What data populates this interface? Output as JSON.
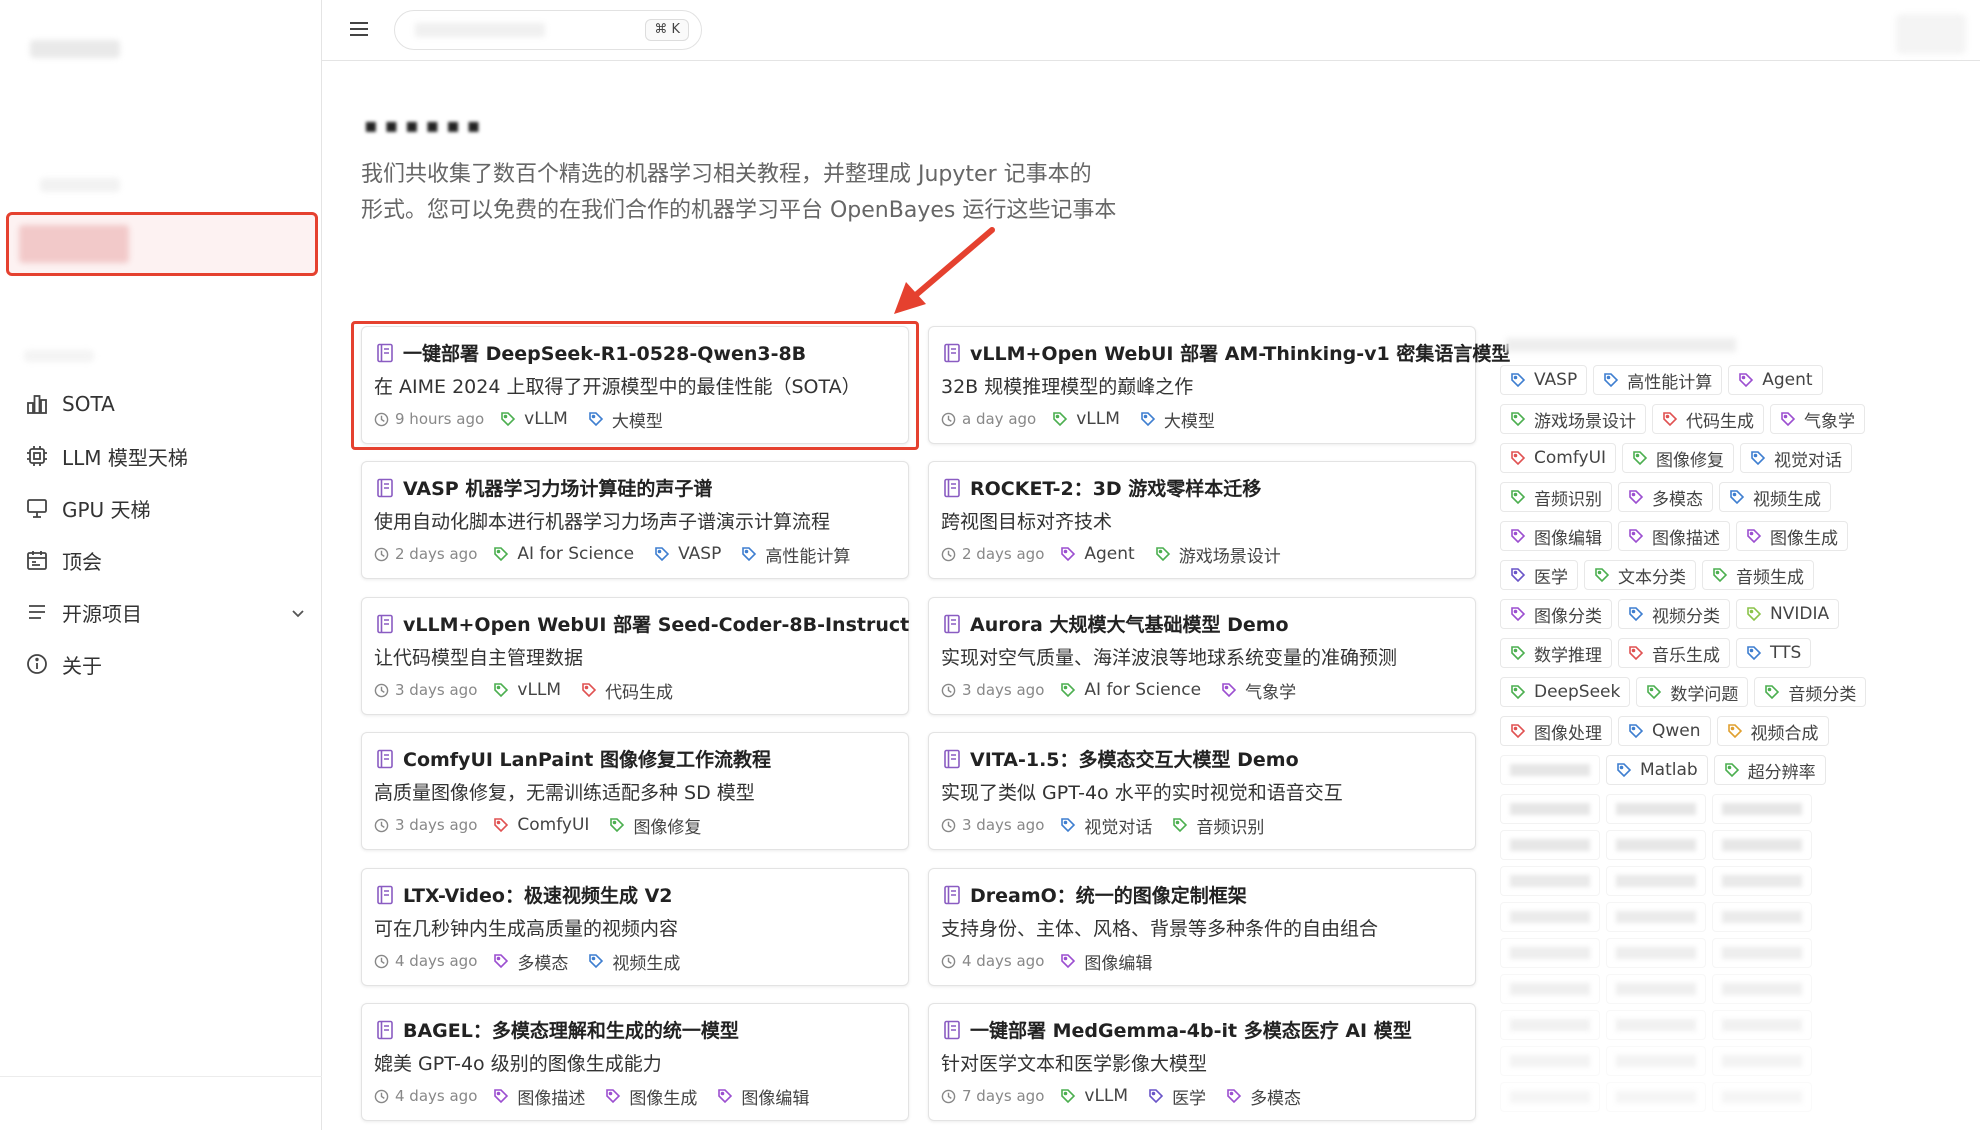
{
  "search": {
    "shortcut": "⌘ K"
  },
  "sidebar": {
    "items": [
      {
        "label": "SOTA",
        "icon": "bar-chart-icon"
      },
      {
        "label": "LLM 模型天梯",
        "icon": "chip-icon"
      },
      {
        "label": "GPU 天梯",
        "icon": "monitor-icon"
      },
      {
        "label": "顶会",
        "icon": "calendar-icon"
      },
      {
        "label": "开源项目",
        "icon": "list-icon",
        "expandable": true
      },
      {
        "label": "关于",
        "icon": "info-icon"
      }
    ]
  },
  "main": {
    "intro": "我们共收集了数百个精选的机器学习相关教程，并整理成 Jupyter 记事本的形式。您可以免费的在我们合作的机器学习平台 OpenBayes 运行这些记事本",
    "intro_line1": "我们共收集了数百个精选的机器学习相关教程，并整理成 Jupyter 记事本的",
    "intro_line2": "形式。您可以免费的在我们合作的机器学习平台 OpenBayes 运行这些记事本",
    "cards": [
      {
        "title": "一键部署 DeepSeek-R1-0528-Qwen3-8B",
        "desc": "在 AIME 2024 上取得了开源模型中的最佳性能（SOTA）",
        "time": "9 hours ago",
        "tags": [
          {
            "name": "vLLM",
            "color": "#4caf50"
          },
          {
            "name": "大模型",
            "color": "#3f7fd0"
          }
        ],
        "highlighted": true
      },
      {
        "title": "vLLM+Open WebUI 部署 AM-Thinking-v1 密集语言模型",
        "desc": "32B 规模推理模型的巅峰之作",
        "time": "a day ago",
        "tags": [
          {
            "name": "vLLM",
            "color": "#4caf50"
          },
          {
            "name": "大模型",
            "color": "#3f7fd0"
          }
        ]
      },
      {
        "title": "VASP 机器学习力场计算硅的声子谱",
        "desc": "使用自动化脚本进行机器学习力场声子谱演示计算流程",
        "time": "2 days ago",
        "tags": [
          {
            "name": "AI for Science",
            "color": "#4caf50"
          },
          {
            "name": "VASP",
            "color": "#3f7fd0"
          },
          {
            "name": "高性能计算",
            "color": "#3f7fd0"
          }
        ]
      },
      {
        "title": "ROCKET-2：3D 游戏零样本迁移",
        "desc": "跨视图目标对齐技术",
        "time": "2 days ago",
        "tags": [
          {
            "name": "Agent",
            "color": "#9c4fd0"
          },
          {
            "name": "游戏场景设计",
            "color": "#4caf50"
          }
        ]
      },
      {
        "title": "vLLM+Open WebUI 部署 Seed-Coder-8B-Instruct",
        "desc": "让代码模型自主管理数据",
        "time": "3 days ago",
        "tags": [
          {
            "name": "vLLM",
            "color": "#4caf50"
          },
          {
            "name": "代码生成",
            "color": "#e05252"
          }
        ]
      },
      {
        "title": "Aurora 大规模大气基础模型 Demo",
        "desc": "实现对空气质量、海洋波浪等地球系统变量的准确预测",
        "time": "3 days ago",
        "tags": [
          {
            "name": "AI for Science",
            "color": "#4caf50"
          },
          {
            "name": "气象学",
            "color": "#9c4fd0"
          }
        ]
      },
      {
        "title": "ComfyUI LanPaint 图像修复工作流教程",
        "desc": "高质量图像修复，无需训练适配多种 SD 模型",
        "time": "3 days ago",
        "tags": [
          {
            "name": "ComfyUI",
            "color": "#e05252"
          },
          {
            "name": "图像修复",
            "color": "#4caf50"
          }
        ]
      },
      {
        "title": "VITA-1.5：多模态交互大模型 Demo",
        "desc": "实现了类似 GPT-4o 水平的实时视觉和语音交互",
        "time": "3 days ago",
        "tags": [
          {
            "name": "视觉对话",
            "color": "#3f7fd0"
          },
          {
            "name": "音频识别",
            "color": "#4caf50"
          }
        ]
      },
      {
        "title": "LTX-Video：极速视频生成 V2",
        "desc": "可在几秒钟内生成高质量的视频内容",
        "time": "4 days ago",
        "tags": [
          {
            "name": "多模态",
            "color": "#9c4fd0"
          },
          {
            "name": "视频生成",
            "color": "#3f7fd0"
          }
        ]
      },
      {
        "title": "DreamO：统一的图像定制框架",
        "desc": "支持身份、主体、风格、背景等多种条件的自由组合",
        "time": "4 days ago",
        "tags": [
          {
            "name": "图像编辑",
            "color": "#9c4fd0"
          }
        ]
      },
      {
        "title": "BAGEL：多模态理解和生成的统一模型",
        "desc": "媲美 GPT-4o 级别的图像生成能力",
        "time": "4 days ago",
        "tags": [
          {
            "name": "图像描述",
            "color": "#9c4fd0"
          },
          {
            "name": "图像生成",
            "color": "#9c4fd0"
          },
          {
            "name": "图像编辑",
            "color": "#9c4fd0"
          }
        ]
      },
      {
        "title": "一键部署 MedGemma-4b-it 多模态医疗 AI 模型",
        "desc": "针对医学文本和医学影像大模型",
        "time": "7 days ago",
        "tags": [
          {
            "name": "vLLM",
            "color": "#4caf50"
          },
          {
            "name": "医学",
            "color": "#6a55c8"
          },
          {
            "name": "多模态",
            "color": "#9c4fd0"
          }
        ]
      }
    ]
  },
  "tag_cloud": [
    [
      {
        "name": "VASP",
        "color": "#3f7fd0"
      },
      {
        "name": "高性能计算",
        "color": "#3f7fd0"
      },
      {
        "name": "Agent",
        "color": "#9c4fd0"
      }
    ],
    [
      {
        "name": "游戏场景设计",
        "color": "#4caf50"
      },
      {
        "name": "代码生成",
        "color": "#e05252"
      },
      {
        "name": "气象学",
        "color": "#9c4fd0"
      }
    ],
    [
      {
        "name": "ComfyUI",
        "color": "#e05252"
      },
      {
        "name": "图像修复",
        "color": "#4caf50"
      },
      {
        "name": "视觉对话",
        "color": "#3f7fd0"
      }
    ],
    [
      {
        "name": "音频识别",
        "color": "#4caf50"
      },
      {
        "name": "多模态",
        "color": "#9c4fd0"
      },
      {
        "name": "视频生成",
        "color": "#3f7fd0"
      }
    ],
    [
      {
        "name": "图像编辑",
        "color": "#9c4fd0"
      },
      {
        "name": "图像描述",
        "color": "#9c4fd0"
      },
      {
        "name": "图像生成",
        "color": "#9c4fd0"
      }
    ],
    [
      {
        "name": "医学",
        "color": "#6a55c8"
      },
      {
        "name": "文本分类",
        "color": "#4caf50"
      },
      {
        "name": "音频生成",
        "color": "#4caf50"
      }
    ],
    [
      {
        "name": "图像分类",
        "color": "#9c4fd0"
      },
      {
        "name": "视频分类",
        "color": "#3f7fd0"
      },
      {
        "name": "NVIDIA",
        "color": "#8bc34a"
      }
    ],
    [
      {
        "name": "数学推理",
        "color": "#4caf50"
      },
      {
        "name": "音乐生成",
        "color": "#e05252"
      },
      {
        "name": "TTS",
        "color": "#3f7fd0"
      }
    ],
    [
      {
        "name": "DeepSeek",
        "color": "#4caf50"
      },
      {
        "name": "数学问题",
        "color": "#4caf50"
      },
      {
        "name": "音频分类",
        "color": "#4caf50"
      }
    ],
    [
      {
        "name": "图像处理",
        "color": "#e05252"
      },
      {
        "name": "Qwen",
        "color": "#3f7fd0"
      },
      {
        "name": "视频合成",
        "color": "#e0a030"
      }
    ],
    [
      {
        "name": "Matlab",
        "color": "#3f7fd0"
      },
      {
        "name": "超分辨率",
        "color": "#4caf50"
      }
    ]
  ],
  "colors": {
    "highlight": "#e5412f",
    "border": "#e3e3e3"
  }
}
